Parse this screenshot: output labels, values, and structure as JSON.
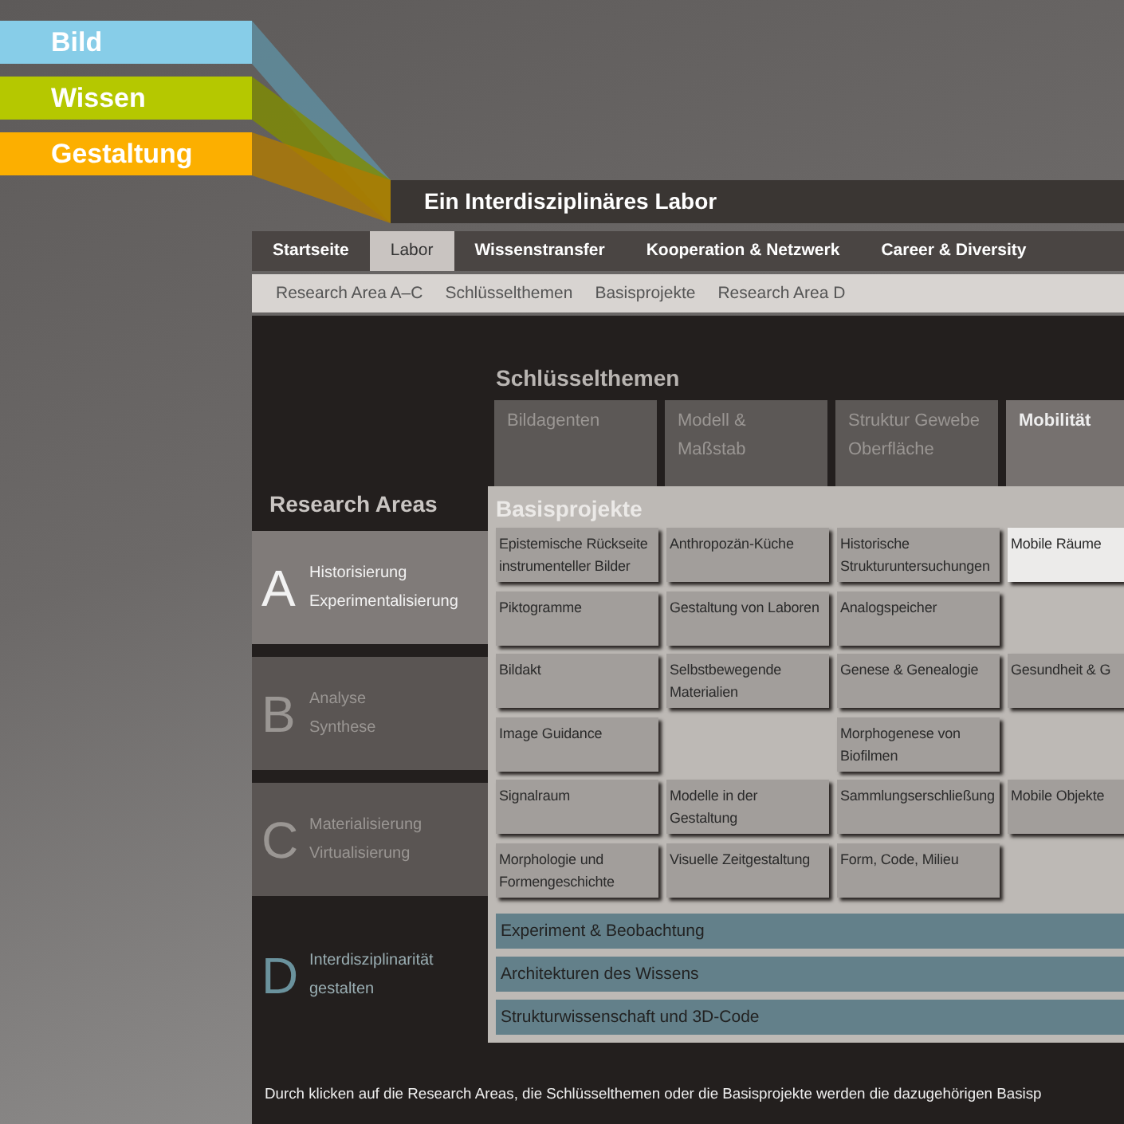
{
  "brand_ribbons": [
    {
      "label": "Bild",
      "color": "#87cde8"
    },
    {
      "label": "Wissen",
      "color": "#b5c800"
    },
    {
      "label": "Gestaltung",
      "color": "#fcaf00"
    }
  ],
  "site_title": "Ein Interdisziplinäres Labor",
  "main_nav": [
    {
      "label": "Startseite",
      "selected": false
    },
    {
      "label": "Labor",
      "selected": true
    },
    {
      "label": "Wissenstransfer",
      "selected": false
    },
    {
      "label": "Kooperation & Netzwerk",
      "selected": false
    },
    {
      "label": "Career & Diversity",
      "selected": false
    }
  ],
  "sub_nav": [
    "Research Area A–C",
    "Schlüsselthemen",
    "Basisprojekte",
    "Research Area D"
  ],
  "research_areas": {
    "title": "Research Areas",
    "items": [
      {
        "kind": "area",
        "letter": "A",
        "lines": [
          "Historisierung",
          "Experimentalisierung"
        ],
        "selected": true
      },
      {
        "kind": "area",
        "letter": "B",
        "lines": [
          "Analyse",
          "Synthese"
        ],
        "selected": false
      },
      {
        "kind": "area",
        "letter": "C",
        "lines": [
          "Materialisierung",
          "Virtualisierung"
        ],
        "selected": false
      },
      {
        "kind": "cross",
        "letter": "D",
        "lines": [
          "Interdisziplinarität",
          "gestalten"
        ],
        "selected": false
      }
    ]
  },
  "key_topics": {
    "title": "Schlüsselthemen",
    "items": [
      {
        "label": "Bildagenten",
        "selected": false
      },
      {
        "label": "Modell & Maßstab",
        "selected": false
      },
      {
        "label": "Struktur Gewebe Oberfläche",
        "selected": false
      },
      {
        "label": "Mobilität",
        "selected": true
      }
    ]
  },
  "base_projects": {
    "title": "Basisprojekte",
    "rows": [
      [
        {
          "kind": "project",
          "label": "Epistemische Rückseite instrumenteller Bilder",
          "selected": false
        },
        {
          "kind": "project",
          "label": "Anthropozän-Küche",
          "selected": false
        },
        {
          "kind": "project",
          "label": "Historische Strukturuntersuchungen",
          "selected": false
        },
        {
          "kind": "project",
          "label": "Mobile Räume",
          "selected": true
        }
      ],
      [
        {
          "kind": "project",
          "label": "Piktogramme",
          "selected": false
        },
        {
          "kind": "project",
          "label": "Gestaltung von Laboren",
          "selected": false
        },
        {
          "kind": "project",
          "label": "Analogspeicher",
          "selected": false
        },
        {
          "kind": "empty"
        }
      ],
      [
        {
          "kind": "project",
          "label": "Bildakt",
          "selected": false
        },
        {
          "kind": "project",
          "label": "Selbstbewegende Materialien",
          "selected": false
        },
        {
          "kind": "project",
          "label": "Genese & Genealogie",
          "selected": false
        },
        {
          "kind": "project",
          "label": "Gesundheit & G",
          "selected": false
        }
      ],
      [
        {
          "kind": "project",
          "label": "Image Guidance",
          "selected": false
        },
        {
          "kind": "empty"
        },
        {
          "kind": "project",
          "label": "Morphogenese von Biofilmen",
          "selected": false
        },
        {
          "kind": "empty"
        }
      ],
      [
        {
          "kind": "project",
          "label": "Signalraum",
          "selected": false
        },
        {
          "kind": "project",
          "label": "Modelle in der Gestaltung",
          "selected": false
        },
        {
          "kind": "project",
          "label": "Sammlungserschließung",
          "selected": false
        },
        {
          "kind": "project",
          "label": "Mobile Objekte",
          "selected": false
        }
      ],
      [
        {
          "kind": "project",
          "label": "Morphologie und Formengeschichte",
          "selected": false
        },
        {
          "kind": "project",
          "label": "Visuelle Zeitgestaltung",
          "selected": false
        },
        {
          "kind": "project",
          "label": "Form, Code, Milieu",
          "selected": false
        },
        {
          "kind": "empty"
        }
      ]
    ],
    "cross_projects": [
      "Experiment & Beobachtung",
      "Architekturen des Wissens",
      "Strukturwissenschaft und 3D-Code"
    ]
  },
  "footer_note": "Durch klicken auf die Research Areas, die Schlüsselthemen oder die Basisprojekte werden die dazugehörigen Basisp"
}
